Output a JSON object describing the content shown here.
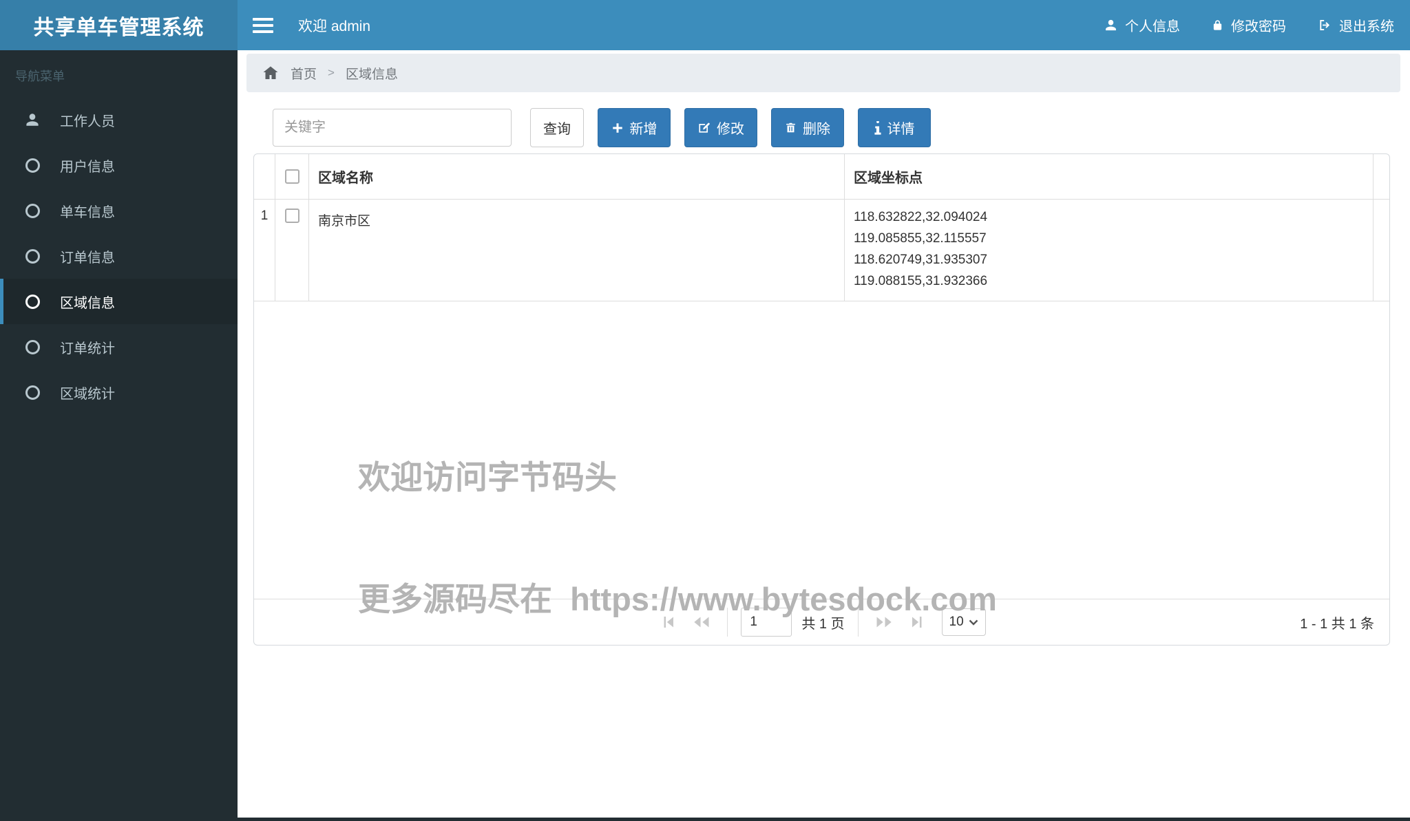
{
  "app": {
    "title": "共享单车管理系统"
  },
  "header": {
    "welcome": "欢迎 admin",
    "menu": [
      {
        "label": "个人信息",
        "icon": "user-icon"
      },
      {
        "label": "修改密码",
        "icon": "lock-icon"
      },
      {
        "label": "退出系统",
        "icon": "sign-out-icon"
      }
    ]
  },
  "sidebar": {
    "section_label": "导航菜单",
    "items": [
      {
        "label": "工作人员",
        "icon": "user-icon",
        "active": false
      },
      {
        "label": "用户信息",
        "icon": "circle-icon",
        "active": false
      },
      {
        "label": "单车信息",
        "icon": "circle-icon",
        "active": false
      },
      {
        "label": "订单信息",
        "icon": "circle-icon",
        "active": false
      },
      {
        "label": "区域信息",
        "icon": "circle-icon",
        "active": true
      },
      {
        "label": "订单统计",
        "icon": "circle-icon",
        "active": false
      },
      {
        "label": "区域统计",
        "icon": "circle-icon",
        "active": false
      }
    ]
  },
  "breadcrumb": {
    "home": "首页",
    "separator": ">",
    "current": "区域信息"
  },
  "toolbar": {
    "search_placeholder": "关键字",
    "search_button": "查询",
    "add_button": "新增",
    "edit_button": "修改",
    "delete_button": "删除",
    "detail_button": "详情"
  },
  "table": {
    "columns": [
      "区域名称",
      "区域坐标点"
    ],
    "rows": [
      {
        "index": "1",
        "name": "南京市区",
        "coords": [
          "118.632822,32.094024",
          "119.085855,32.115557",
          "118.620749,31.935307",
          "119.088155,31.932366"
        ]
      }
    ]
  },
  "watermark": {
    "line1": "欢迎访问字节码头",
    "line2": "更多源码尽在  https://www.bytesdock.com"
  },
  "pagination": {
    "page_value": "1",
    "page_info": "共 1 页",
    "page_size": "10",
    "range_info": "1 - 1   共 1 条"
  },
  "colors": {
    "navbar": "#3c8dbc",
    "logo_bg": "#367fa9",
    "sidebar_bg": "#222d32",
    "sidebar_active_bg": "#1e282c",
    "accent": "#3c8dbc",
    "primary_button": "#337ab7",
    "breadcrumb_bg": "#e9edf1",
    "watermark_text": "#b4b4b4"
  }
}
